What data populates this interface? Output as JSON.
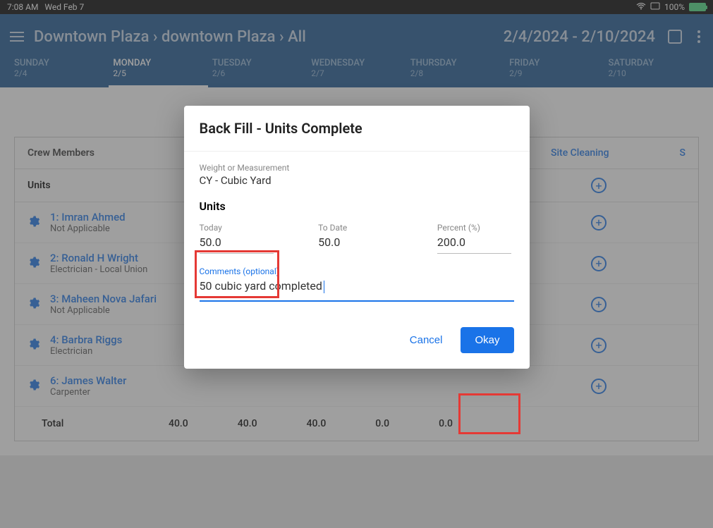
{
  "status": {
    "time": "7:08 AM",
    "date": "Wed Feb 7",
    "battery": "100%"
  },
  "header": {
    "breadcrumb_1": "Downtown Plaza",
    "breadcrumb_2": "downtown Plaza",
    "breadcrumb_3": "All",
    "date_range": "2/4/2024 - 2/10/2024"
  },
  "days": [
    {
      "name": "SUNDAY",
      "date": "2/4"
    },
    {
      "name": "MONDAY",
      "date": "2/5"
    },
    {
      "name": "TUESDAY",
      "date": "2/6"
    },
    {
      "name": "WEDNESDAY",
      "date": "2/7"
    },
    {
      "name": "THURSDAY",
      "date": "2/8"
    },
    {
      "name": "FRIDAY",
      "date": "2/9"
    },
    {
      "name": "SATURDAY",
      "date": "2/10"
    }
  ],
  "active_day_index": 1,
  "table": {
    "header_label": "Crew Members",
    "col_site_cleaning": "Site Cleaning",
    "col_s": "S",
    "units_label": "Units",
    "total_label": "Total",
    "totals": [
      "40.0",
      "40.0",
      "40.0",
      "0.0",
      "0.0"
    ]
  },
  "crew": [
    {
      "idx": "1:",
      "name": "Imran Ahmed",
      "role": "Not Applicable"
    },
    {
      "idx": "2:",
      "name": "Ronald H Wright",
      "role": "Electrician - Local Union"
    },
    {
      "idx": "3:",
      "name": "Maheen  Nova Jafari",
      "role": "Not Applicable"
    },
    {
      "idx": "4:",
      "name": "Barbra Riggs",
      "role": "Electrician"
    },
    {
      "idx": "6:",
      "name": "James Walter",
      "role": "Carpenter"
    }
  ],
  "modal": {
    "title": "Back Fill - Units Complete",
    "measurement_label": "Weight or Measurement",
    "measurement_value": "CY - Cubic Yard",
    "units_section": "Units",
    "today_label": "Today",
    "today_value": "50.0",
    "todate_label": "To Date",
    "todate_value": "50.0",
    "percent_label": "Percent (%)",
    "percent_value": "200.0",
    "comments_label": "Comments (optional)",
    "comments_value": "50 cubic yard completed",
    "cancel": "Cancel",
    "okay": "Okay"
  }
}
